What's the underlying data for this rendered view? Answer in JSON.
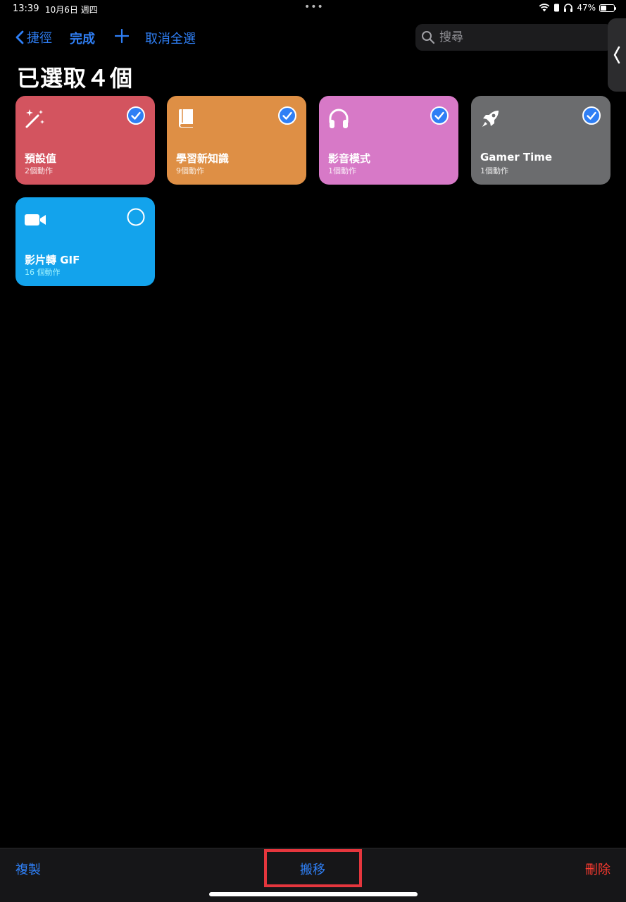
{
  "status": {
    "time": "13:39",
    "date": "10月6日 週四",
    "battery": "47%",
    "battery_level": 0.47
  },
  "nav": {
    "back_label": "捷徑",
    "done_label": "完成",
    "deselect_label": "取消全選",
    "search_placeholder": "搜尋"
  },
  "title": "已選取４個",
  "colors": {
    "accent": "#2f7ff5",
    "destructive": "#ff3b30",
    "highlight": "#e5363d"
  },
  "shortcuts": [
    {
      "name": "預設值",
      "count": "2個動作",
      "color": "#d3545f",
      "icon": "magic-wand-icon",
      "selected": true
    },
    {
      "name": "學習新知識",
      "count": "9個動作",
      "color": "#de8f45",
      "icon": "book-icon",
      "selected": true
    },
    {
      "name": "影音模式",
      "count": "1個動作",
      "color": "#d779c7",
      "icon": "headphones-icon",
      "selected": true
    },
    {
      "name": "Gamer Time",
      "count": "1個動作",
      "color": "#6b6c6e",
      "icon": "rocket-icon",
      "selected": true
    },
    {
      "name": "影片轉 GIF",
      "count": "16 個動作",
      "color": "#13a3ec",
      "icon": "video-camera-icon",
      "selected": false
    }
  ],
  "toolbar": {
    "copy_label": "複製",
    "move_label": "搬移",
    "delete_label": "刪除"
  }
}
